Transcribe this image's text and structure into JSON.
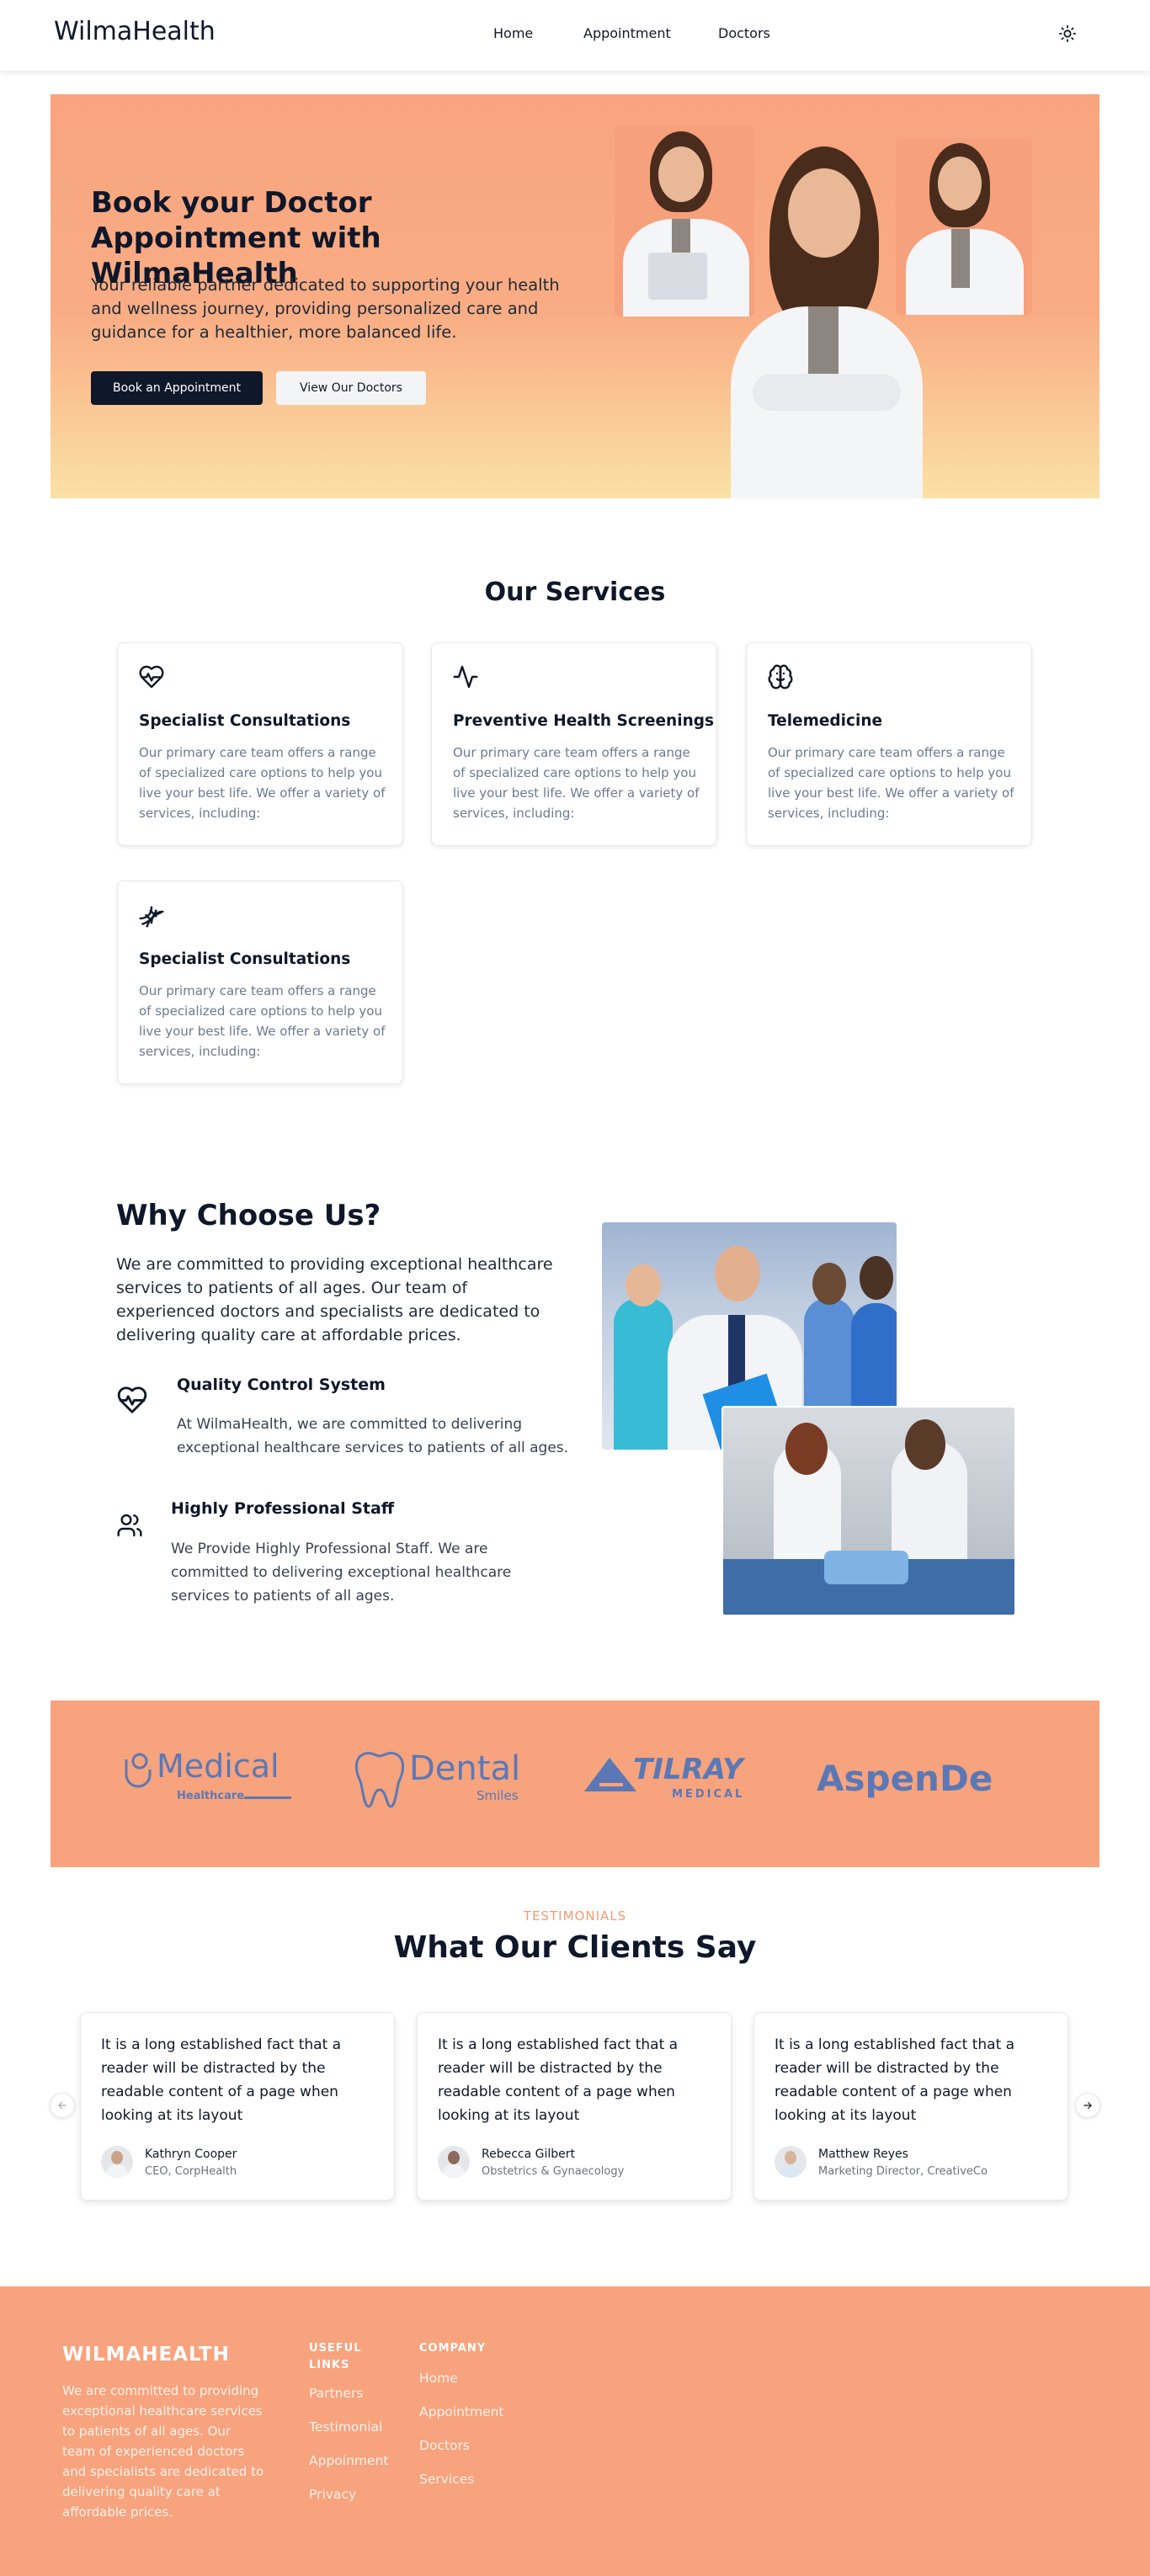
{
  "nav": {
    "brand": "WilmaHealth",
    "links": [
      "Home",
      "Appointment",
      "Doctors"
    ],
    "theme_icon": "sun-icon"
  },
  "hero": {
    "title": "Book your Doctor Appointment with WilmaHealth",
    "description": "Your reliable partner dedicated to supporting your health and wellness journey, providing personalized care and guidance for a healthier, more balanced life.",
    "primary_button": "Book an Appointment",
    "secondary_button": "View Our Doctors"
  },
  "services": {
    "title": "Our Services",
    "items": [
      {
        "icon": "heart-pulse-icon",
        "title": "Specialist Consultations",
        "description": "Our primary care team offers a range of specialized care options to help you live your best life. We offer a variety of services, including:"
      },
      {
        "icon": "activity-icon",
        "title": "Preventive Health Screenings",
        "description": "Our primary care team offers a range of specialized care options to help you live your best life. We offer a variety of services, including:"
      },
      {
        "icon": "brain-icon",
        "title": "Telemedicine",
        "description": "Our primary care team offers a range of specialized care options to help you live your best life. We offer a variety of services, including:"
      },
      {
        "icon": "dna-icon",
        "title": "Specialist Consultations",
        "description": "Our primary care team offers a range of specialized care options to help you live your best life. We offer a variety of services, including:"
      }
    ]
  },
  "why": {
    "title": "Why Choose Us?",
    "description": "We are committed to providing exceptional healthcare services to patients of all ages. Our team of experienced doctors and specialists are dedicated to delivering quality care at affordable prices.",
    "features": [
      {
        "icon": "heart-pulse-icon",
        "title": "Quality Control System",
        "description": "At WilmaHealth, we are committed to delivering exceptional healthcare services to patients of all ages."
      },
      {
        "icon": "users-icon",
        "title": "Highly Professional Staff",
        "description": "We Provide Highly Professional Staff. We are committed to delivering exceptional healthcare services to patients of all ages."
      }
    ]
  },
  "partners": {
    "logos": [
      {
        "main": "Medical",
        "sub": "Healthcare"
      },
      {
        "main": "Dental",
        "sub": "Smiles"
      },
      {
        "main": "TILRAY",
        "sub": "MEDICAL"
      },
      {
        "main": "AspenDe",
        "sub": ""
      }
    ],
    "logo_color": "#5b78b5"
  },
  "testimonials": {
    "kicker": "TESTIMONIALS",
    "title": "What Our Clients Say",
    "items": [
      {
        "quote": "It is a long established fact that a reader will be distracted by the readable content of a page when looking at its layout",
        "name": "Kathryn Cooper",
        "role": "CEO, CorpHealth"
      },
      {
        "quote": "It is a long established fact that a reader will be distracted by the readable content of a page when looking at its layout",
        "name": "Rebecca Gilbert",
        "role": "Obstetrics & Gynaecology"
      },
      {
        "quote": "It is a long established fact that a reader will be distracted by the readable content of a page when looking at its layout",
        "name": "Matthew Reyes",
        "role": "Marketing Director, CreativeCo"
      }
    ],
    "prev_icon": "arrow-left-icon",
    "next_icon": "arrow-right-icon"
  },
  "footer": {
    "brand": "WILMAHEALTH",
    "description": "We are committed to providing exceptional healthcare services to patients of all ages. Our team of experienced doctors and specialists are dedicated to delivering quality care at affordable prices.",
    "useful_links_heading": "USEFUL LINKS",
    "useful_links": [
      "Partners",
      "Testimonial",
      "Appoinment",
      "Privacy"
    ],
    "company_heading": "COMPANY",
    "company_links": [
      "Home",
      "Appointment",
      "Doctors",
      "Services"
    ]
  },
  "colors": {
    "accent": "#f7a37e",
    "dark": "#0f172a",
    "muted_text": "#6b7a90"
  }
}
